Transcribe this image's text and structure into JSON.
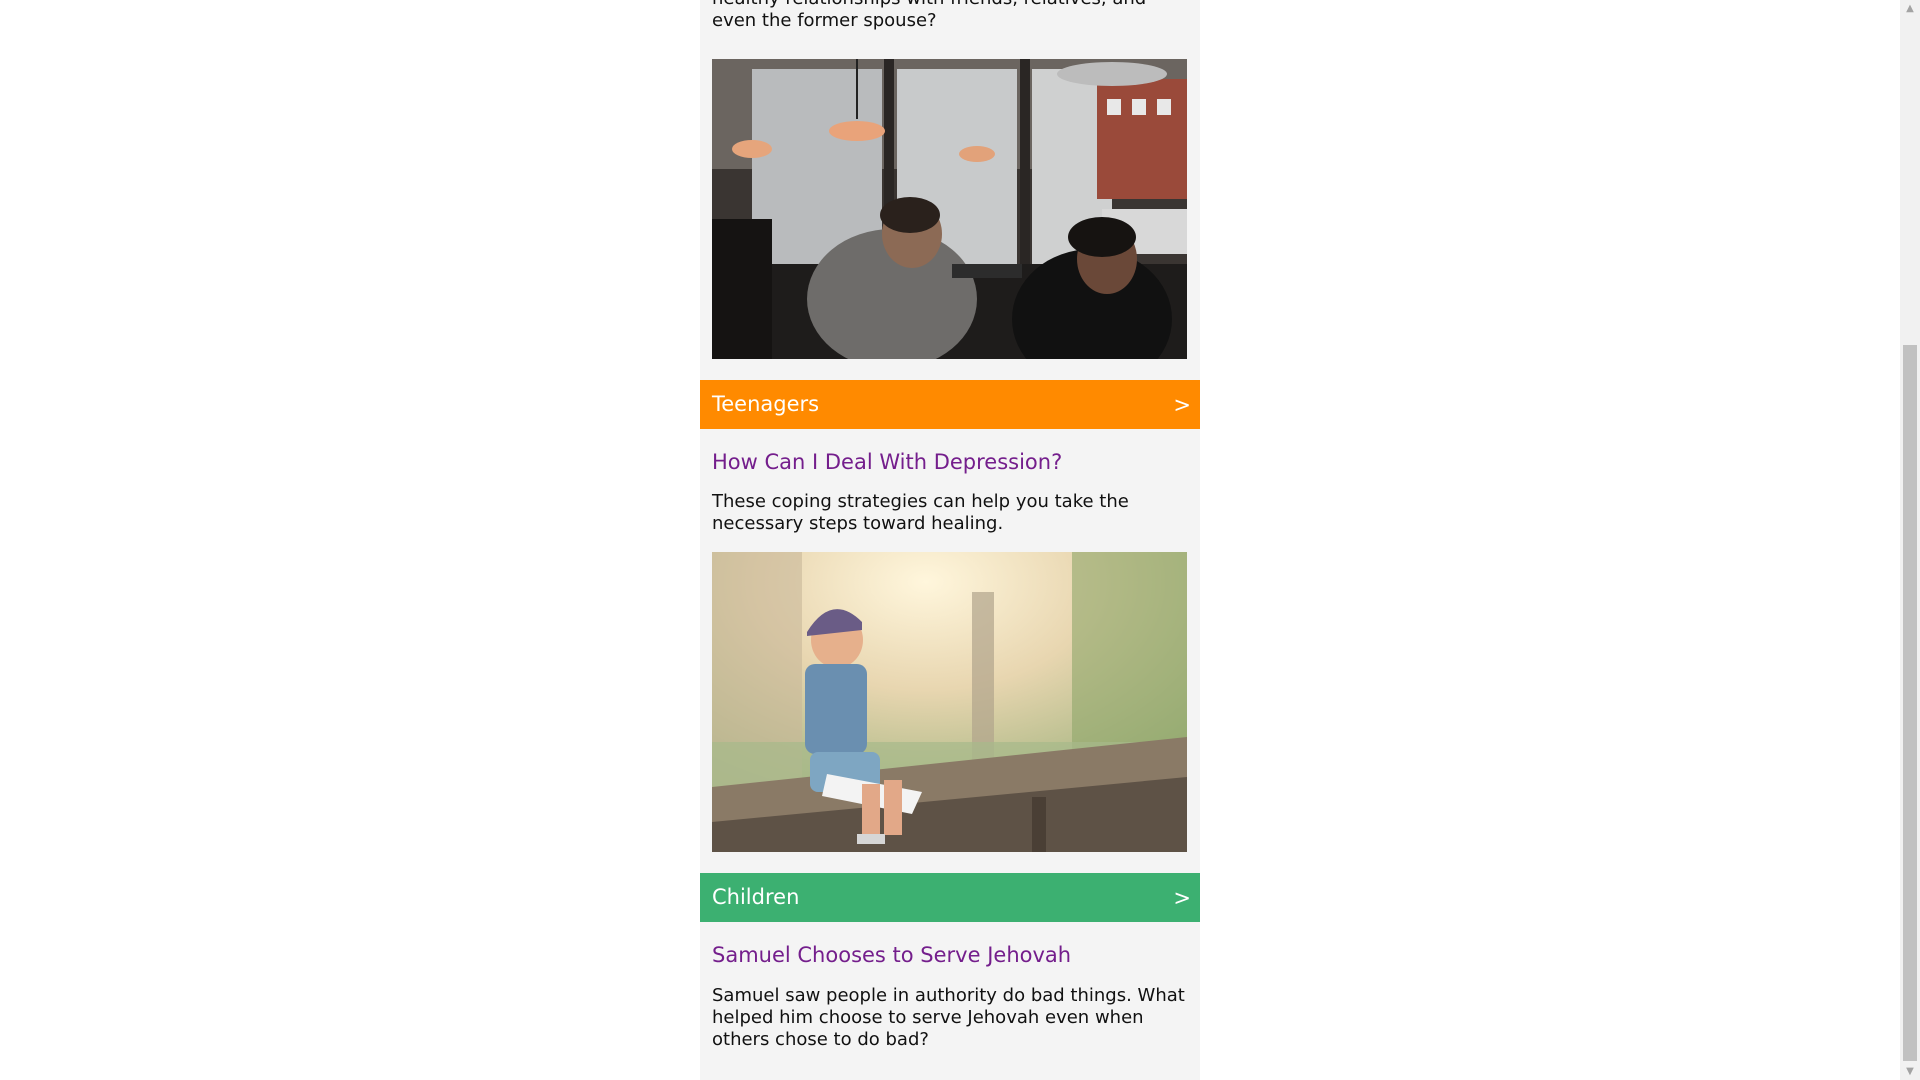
{
  "intro": {
    "text_line": "healthy relationships with friends, relatives, and even the former spouse?"
  },
  "sections": [
    {
      "category": "Teenagers",
      "arrow": ">",
      "color": "#ff8a00",
      "title": "How Can I Deal With Depression?",
      "summary": "These coping strategies can help you take the necessary steps toward healing."
    },
    {
      "category": "Children",
      "arrow": ">",
      "color": "#3cb071",
      "title": "Samuel Chooses to Serve Jehovah",
      "summary": "Samuel saw people in authority do bad things. What helped him choose to serve Jehovah even when others chose to do bad?"
    }
  ],
  "colors": {
    "link": "#741e8c",
    "column_bg": "#f4f4f4"
  },
  "scrollbar": {
    "up_icon": "▲",
    "down_icon": "▼"
  }
}
